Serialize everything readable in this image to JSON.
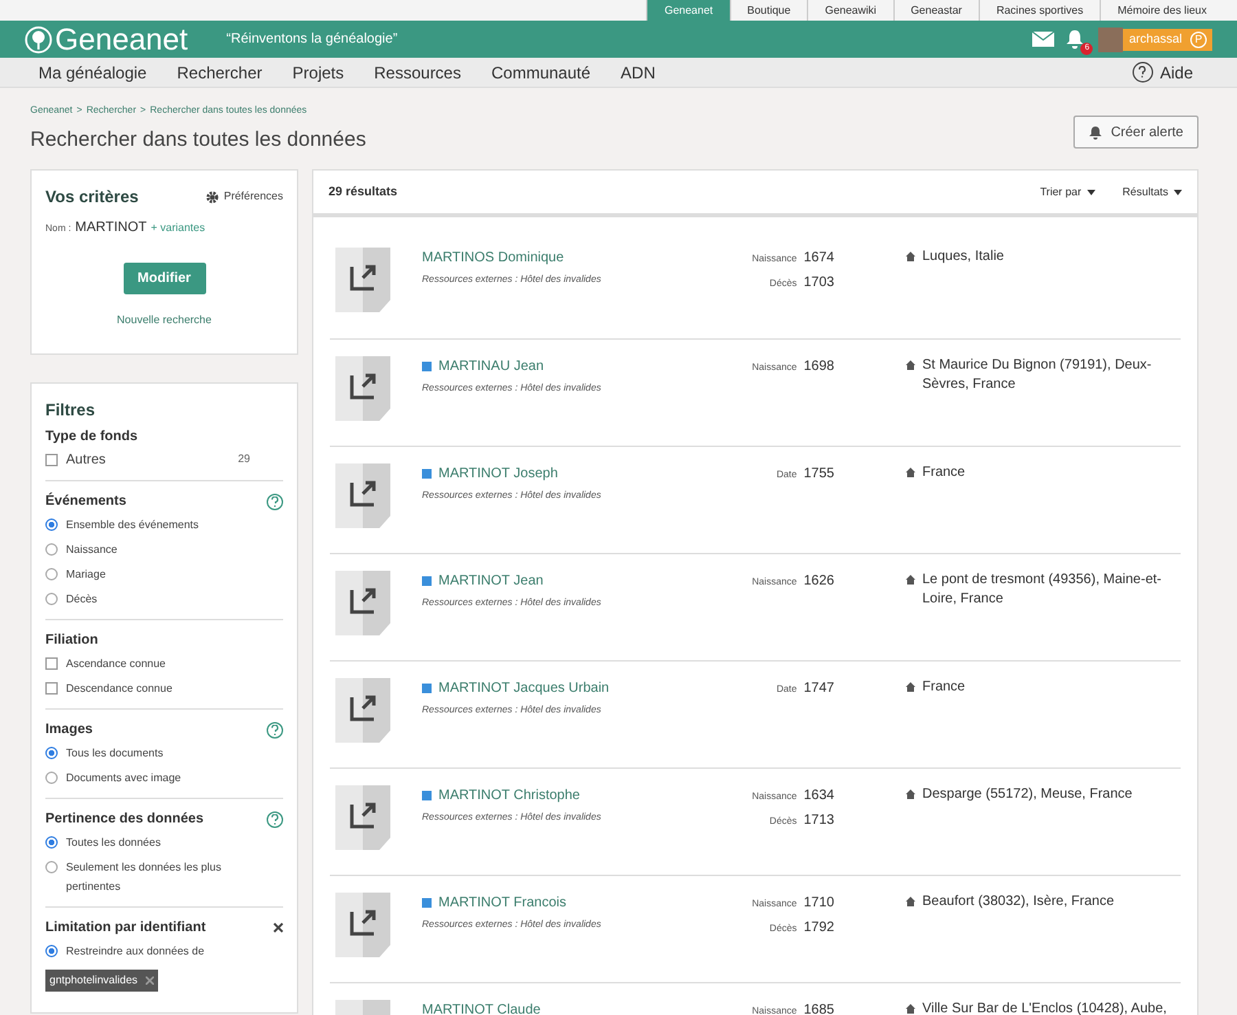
{
  "top_tabs": [
    {
      "label": "Geneanet",
      "selected": true
    },
    {
      "label": "Boutique",
      "selected": false
    },
    {
      "label": "Geneawiki",
      "selected": false
    },
    {
      "label": "Geneastar",
      "selected": false
    },
    {
      "label": "Racines sportives",
      "selected": false
    },
    {
      "label": "Mémoire des lieux",
      "selected": false
    }
  ],
  "header": {
    "logo": "Geneanet",
    "slogan": "“Réinventons la généalogie”",
    "notifications": "6",
    "username": "archassal",
    "badge": "P"
  },
  "nav": {
    "items": [
      "Ma généalogie",
      "Rechercher",
      "Projets",
      "Ressources",
      "Communauté",
      "ADN"
    ],
    "help": "Aide"
  },
  "breadcrumb": [
    "Geneanet",
    "Rechercher",
    "Rechercher dans toutes les données"
  ],
  "breadcrumb_separator": ">",
  "page_title": "Rechercher dans toutes les données",
  "alert_button": "Créer alerte",
  "criteria": {
    "title": "Vos critères",
    "preferences": "Préférences",
    "name_label": "Nom :",
    "name_value": "MARTINOT",
    "variants": "+ variantes",
    "modify": "Modifier",
    "new_search": "Nouvelle recherche"
  },
  "filters": {
    "title": "Filtres",
    "sections": [
      {
        "title": "Type de fonds",
        "help": false,
        "closable": false,
        "options": [
          {
            "kind": "checkbox",
            "label": "Autres",
            "checked": false,
            "count": "29"
          }
        ]
      },
      {
        "title": "Événements",
        "help": true,
        "closable": false,
        "options": [
          {
            "kind": "radio",
            "label": "Ensemble des événements",
            "checked": true
          },
          {
            "kind": "radio",
            "label": "Naissance",
            "checked": false
          },
          {
            "kind": "radio",
            "label": "Mariage",
            "checked": false
          },
          {
            "kind": "radio",
            "label": "Décès",
            "checked": false
          }
        ]
      },
      {
        "title": "Filiation",
        "help": false,
        "closable": false,
        "options": [
          {
            "kind": "checkbox",
            "label": "Ascendance connue",
            "checked": false
          },
          {
            "kind": "checkbox",
            "label": "Descendance connue",
            "checked": false
          }
        ]
      },
      {
        "title": "Images",
        "help": true,
        "closable": false,
        "options": [
          {
            "kind": "radio",
            "label": "Tous les documents",
            "checked": true
          },
          {
            "kind": "radio",
            "label": "Documents avec image",
            "checked": false
          }
        ]
      },
      {
        "title": "Pertinence des données",
        "help": true,
        "closable": false,
        "options": [
          {
            "kind": "radio",
            "label": "Toutes les données",
            "checked": true
          },
          {
            "kind": "radio",
            "label": "Seulement les données les plus pertinentes",
            "checked": false
          }
        ]
      },
      {
        "title": "Limitation par identifiant",
        "help": false,
        "closable": true,
        "options": [
          {
            "kind": "radio",
            "label": "Restreindre aux données de",
            "checked": true
          }
        ],
        "tag": "gntphotelinvalides"
      }
    ]
  },
  "results": {
    "count": "29 résultats",
    "sort": "Trier par",
    "display": "Résultats",
    "rows": [
      {
        "name": "MARTINOS Dominique",
        "marked": false,
        "source": "Ressources externes : Hôtel des invalides",
        "events": [
          {
            "label": "Naissance",
            "year": "1674"
          },
          {
            "label": "Décès",
            "year": "1703"
          }
        ],
        "place": "Luques, Italie"
      },
      {
        "name": "MARTINAU Jean",
        "marked": true,
        "source": "Ressources externes : Hôtel des invalides",
        "events": [
          {
            "label": "Naissance",
            "year": "1698"
          }
        ],
        "place": "St Maurice Du Bignon (79191), Deux-Sèvres, France"
      },
      {
        "name": "MARTINOT Joseph",
        "marked": true,
        "source": "Ressources externes : Hôtel des invalides",
        "events": [
          {
            "label": "Date",
            "year": "1755"
          }
        ],
        "place": "France"
      },
      {
        "name": "MARTINOT Jean",
        "marked": true,
        "source": "Ressources externes : Hôtel des invalides",
        "events": [
          {
            "label": "Naissance",
            "year": "1626"
          }
        ],
        "place": "Le pont de tresmont (49356), Maine-et-Loire, France"
      },
      {
        "name": "MARTINOT Jacques Urbain",
        "marked": true,
        "source": "Ressources externes : Hôtel des invalides",
        "events": [
          {
            "label": "Date",
            "year": "1747"
          }
        ],
        "place": "France"
      },
      {
        "name": "MARTINOT Christophe",
        "marked": true,
        "source": "Ressources externes : Hôtel des invalides",
        "events": [
          {
            "label": "Naissance",
            "year": "1634"
          },
          {
            "label": "Décès",
            "year": "1713"
          }
        ],
        "place": "Desparge (55172), Meuse, France"
      },
      {
        "name": "MARTINOT Francois",
        "marked": true,
        "source": "Ressources externes : Hôtel des invalides",
        "events": [
          {
            "label": "Naissance",
            "year": "1710"
          },
          {
            "label": "Décès",
            "year": "1792"
          }
        ],
        "place": "Beaufort (38032), Isère, France"
      },
      {
        "name": "MARTINOT Claude",
        "marked": false,
        "events": [
          {
            "label": "Naissance",
            "year": "1685"
          }
        ],
        "place": "Ville Sur Bar de L'Enclos (10428), Aube,"
      }
    ]
  }
}
